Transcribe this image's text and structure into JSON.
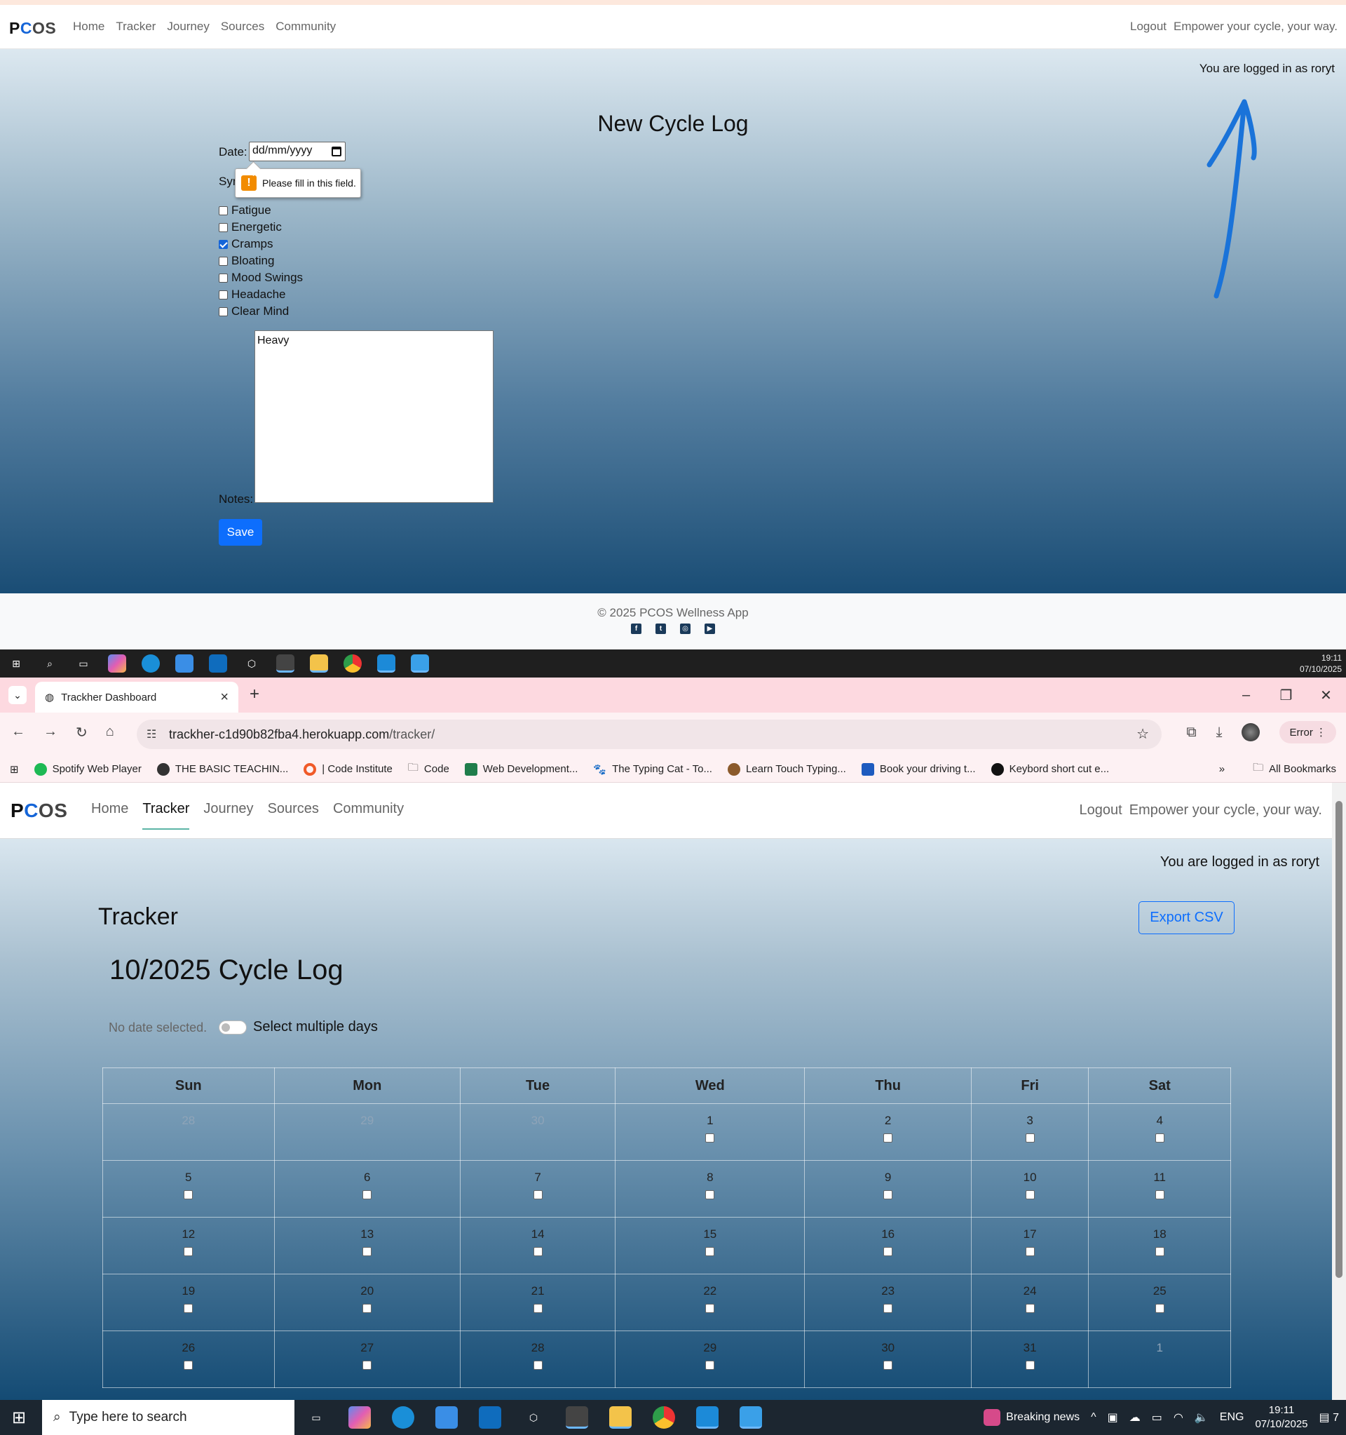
{
  "top_app": {
    "brand": {
      "p": "P",
      "c": "C",
      "os": "OS"
    },
    "nav": [
      "Home",
      "Tracker",
      "Journey",
      "Sources",
      "Community"
    ],
    "logout": "Logout",
    "tagline": "Empower your cycle, your way.",
    "login_status": "You are logged in as roryt",
    "title": "New Cycle Log",
    "date_label": "Date:",
    "date_placeholder": "dd/mm/yyyy",
    "symptoms_label_partial": "Syr",
    "tooltip": "Please fill in this field.",
    "symptoms": [
      {
        "label": "Fatigue",
        "checked": false
      },
      {
        "label": "Energetic",
        "checked": false
      },
      {
        "label": "Cramps",
        "checked": true
      },
      {
        "label": "Bloating",
        "checked": false
      },
      {
        "label": "Mood Swings",
        "checked": false
      },
      {
        "label": "Headache",
        "checked": false
      },
      {
        "label": "Clear Mind",
        "checked": false
      }
    ],
    "notes_label": "Notes:",
    "notes_value": "Heavy",
    "save": "Save",
    "footer_copy": "© 2025 PCOS Wellness App",
    "socials": [
      "facebook-icon",
      "twitter-icon",
      "instagram-icon",
      "youtube-icon"
    ],
    "annotation_color": "#1a73d9"
  },
  "taskbar1": {
    "time": "19:11",
    "date": "07/10/2025"
  },
  "browser": {
    "tab_title": "Trackher Dashboard",
    "url_host": "trackher-c1d90b82fba4.herokuapp.com",
    "url_path": "/tracker/",
    "profile_status": "Error",
    "bookmarks": [
      "Spotify Web Player",
      "THE BASIC TEACHIN...",
      "| Code Institute",
      "Code",
      "Web Development...",
      "The Typing Cat - To...",
      "Learn Touch Typing...",
      "Book your driving t...",
      "Keybord short cut e..."
    ],
    "more": "»",
    "all_bookmarks": "All Bookmarks"
  },
  "tracker_page": {
    "brand": {
      "p": "P",
      "c": "C",
      "os": "OS"
    },
    "nav": [
      "Home",
      "Tracker",
      "Journey",
      "Sources",
      "Community"
    ],
    "active_nav": "Tracker",
    "logout": "Logout",
    "tagline": "Empower your cycle, your way.",
    "login_status": "You are logged in as roryt",
    "heading": "Tracker",
    "export": "Export CSV",
    "cycle_heading": "10/2025 Cycle Log",
    "no_date": "No date selected.",
    "multi_label": "Select multiple days",
    "weekdays": [
      "Sun",
      "Mon",
      "Tue",
      "Wed",
      "Thu",
      "Fri",
      "Sat"
    ],
    "weeks": [
      [
        {
          "d": "28",
          "dim": true
        },
        {
          "d": "29",
          "dim": true
        },
        {
          "d": "30",
          "dim": true
        },
        {
          "d": "1"
        },
        {
          "d": "2"
        },
        {
          "d": "3"
        },
        {
          "d": "4"
        }
      ],
      [
        {
          "d": "5"
        },
        {
          "d": "6"
        },
        {
          "d": "7"
        },
        {
          "d": "8"
        },
        {
          "d": "9"
        },
        {
          "d": "10"
        },
        {
          "d": "11"
        }
      ],
      [
        {
          "d": "12"
        },
        {
          "d": "13"
        },
        {
          "d": "14"
        },
        {
          "d": "15"
        },
        {
          "d": "16"
        },
        {
          "d": "17"
        },
        {
          "d": "18"
        }
      ],
      [
        {
          "d": "19"
        },
        {
          "d": "20"
        },
        {
          "d": "21"
        },
        {
          "d": "22"
        },
        {
          "d": "23"
        },
        {
          "d": "24"
        },
        {
          "d": "25"
        }
      ],
      [
        {
          "d": "26"
        },
        {
          "d": "27"
        },
        {
          "d": "28"
        },
        {
          "d": "29"
        },
        {
          "d": "30"
        },
        {
          "d": "31"
        },
        {
          "d": "1",
          "dim": true
        }
      ]
    ]
  },
  "taskbar2": {
    "search_placeholder": "Type here to search",
    "news": "Breaking news",
    "lang": "ENG",
    "time": "19:11",
    "date": "07/10/2025",
    "notif_count": "7"
  }
}
